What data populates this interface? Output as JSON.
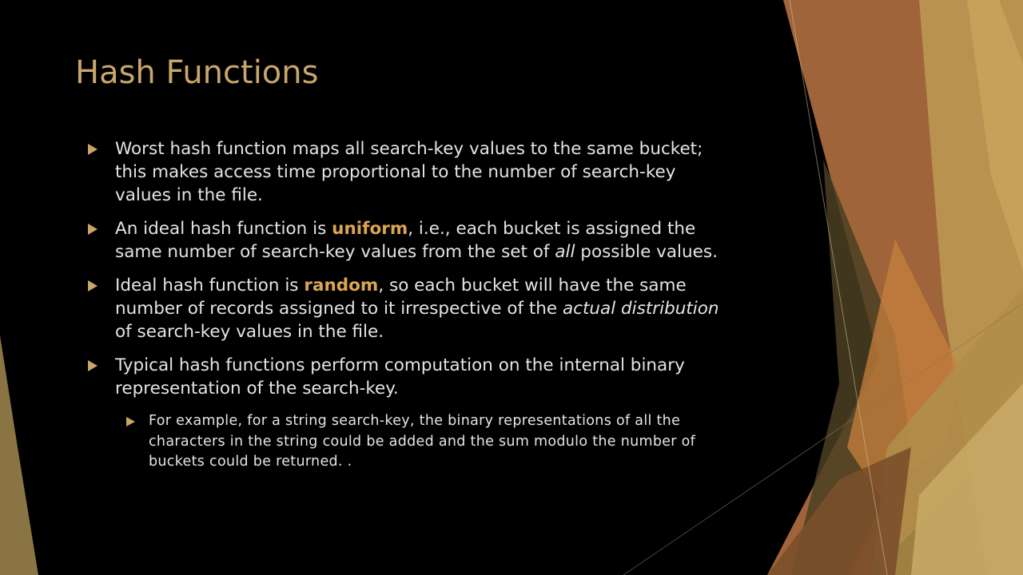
{
  "slide": {
    "title": "Hash Functions",
    "bullets": [
      {
        "text": "Worst hash function maps all search-key values to the same bucket; this makes access time proportional to the number of search-key values in the file."
      },
      {
        "before": "An ideal hash function is ",
        "highlight": "uniform",
        "middle": ", i.e., each bucket is assigned the same number of search-key values from the set of ",
        "italic": "all",
        "after": " possible values."
      },
      {
        "before": "Ideal hash function is ",
        "highlight": "random",
        "middle": ", so each bucket will have the same number of records assigned to it irrespective of the ",
        "italic": "actual distribution",
        "after": " of search-key values in the file."
      },
      {
        "text": "Typical hash functions perform computation on the internal binary representation of the search-key."
      }
    ],
    "sub_bullets": [
      {
        "text": "For example, for a string search-key, the binary representations of all the characters in the string could be added and the sum modulo the number of buckets could be returned. ."
      }
    ]
  },
  "theme": {
    "background": "#000000",
    "title_color": "#c8a66a",
    "text_color": "#e4e4e4",
    "highlight_color": "#dba552",
    "bullet_marker": "triangle-right"
  }
}
